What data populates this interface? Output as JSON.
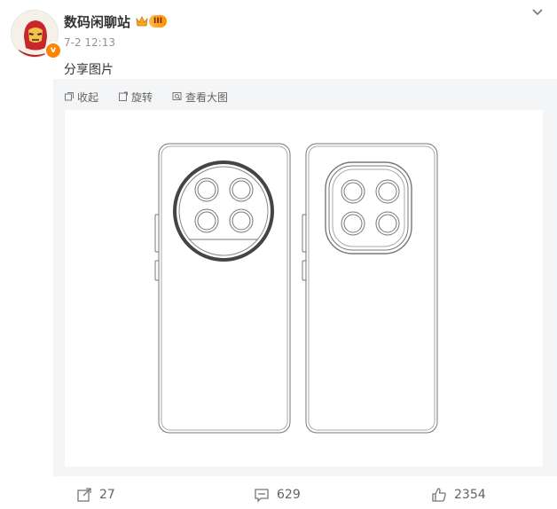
{
  "post": {
    "author": "数码闲聊站",
    "member_level": "III",
    "verified_mark": "v",
    "timestamp": "7-2 12:13",
    "text": "分享图片"
  },
  "media_toolbar": {
    "collapse_label": "收起",
    "rotate_label": "旋转",
    "view_large_label": "查看大图"
  },
  "actions": {
    "repost_count": "27",
    "comment_count": "629",
    "like_count": "2354"
  },
  "colors": {
    "accent": "#ff8200",
    "muted_text": "#939393",
    "panel_bg": "#f4f5f6"
  },
  "icons": [
    "chevron-down-icon",
    "crown-icon",
    "collapse-icon",
    "rotate-icon",
    "zoom-icon",
    "repost-icon",
    "comment-icon",
    "like-icon"
  ]
}
